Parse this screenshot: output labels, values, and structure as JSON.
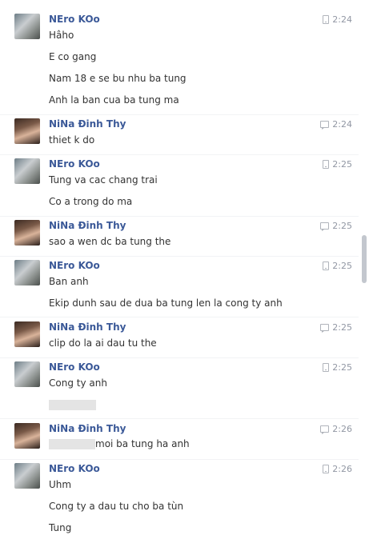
{
  "top_fragment": "°",
  "messages": [
    {
      "name": "NEro KOo",
      "time": "2:24",
      "via": "mobile",
      "lines": [
        "Hâho",
        "E co gang",
        "Nam 18 e se bu nhu ba tung",
        "Anh la ban cua ba tung ma"
      ]
    },
    {
      "name": "NiNa Đinh Thy",
      "time": "2:24",
      "via": "chat",
      "lines": [
        "thiet k do"
      ]
    },
    {
      "name": "NEro KOo",
      "time": "2:25",
      "via": "mobile",
      "lines": [
        "Tung va cac chang trai",
        "Co a trong do ma"
      ]
    },
    {
      "name": "NiNa Đinh Thy",
      "time": "2:25",
      "via": "chat",
      "lines": [
        "sao a wen dc ba tung the"
      ]
    },
    {
      "name": "NEro KOo",
      "time": "2:25",
      "via": "mobile",
      "lines": [
        "Ban anh",
        "Ekip dunh sau de dua ba tung len la cong ty anh"
      ]
    },
    {
      "name": "NiNa Đinh Thy",
      "time": "2:25",
      "via": "chat",
      "lines": [
        "clip do la ai dau tu the"
      ]
    },
    {
      "name": "NEro KOo",
      "time": "2:25",
      "via": "mobile",
      "lines": [
        "Cong ty anh"
      ]
    },
    {
      "name": "NiNa Đinh Thy",
      "time": "2:26",
      "via": "chat",
      "lines": [
        "moi ba tung ha anh"
      ]
    },
    {
      "name": "NEro KOo",
      "time": "2:26",
      "via": "mobile",
      "lines": [
        "Uhm",
        "Cong ty a dau tu cho ba tùn",
        "Tung"
      ]
    }
  ]
}
